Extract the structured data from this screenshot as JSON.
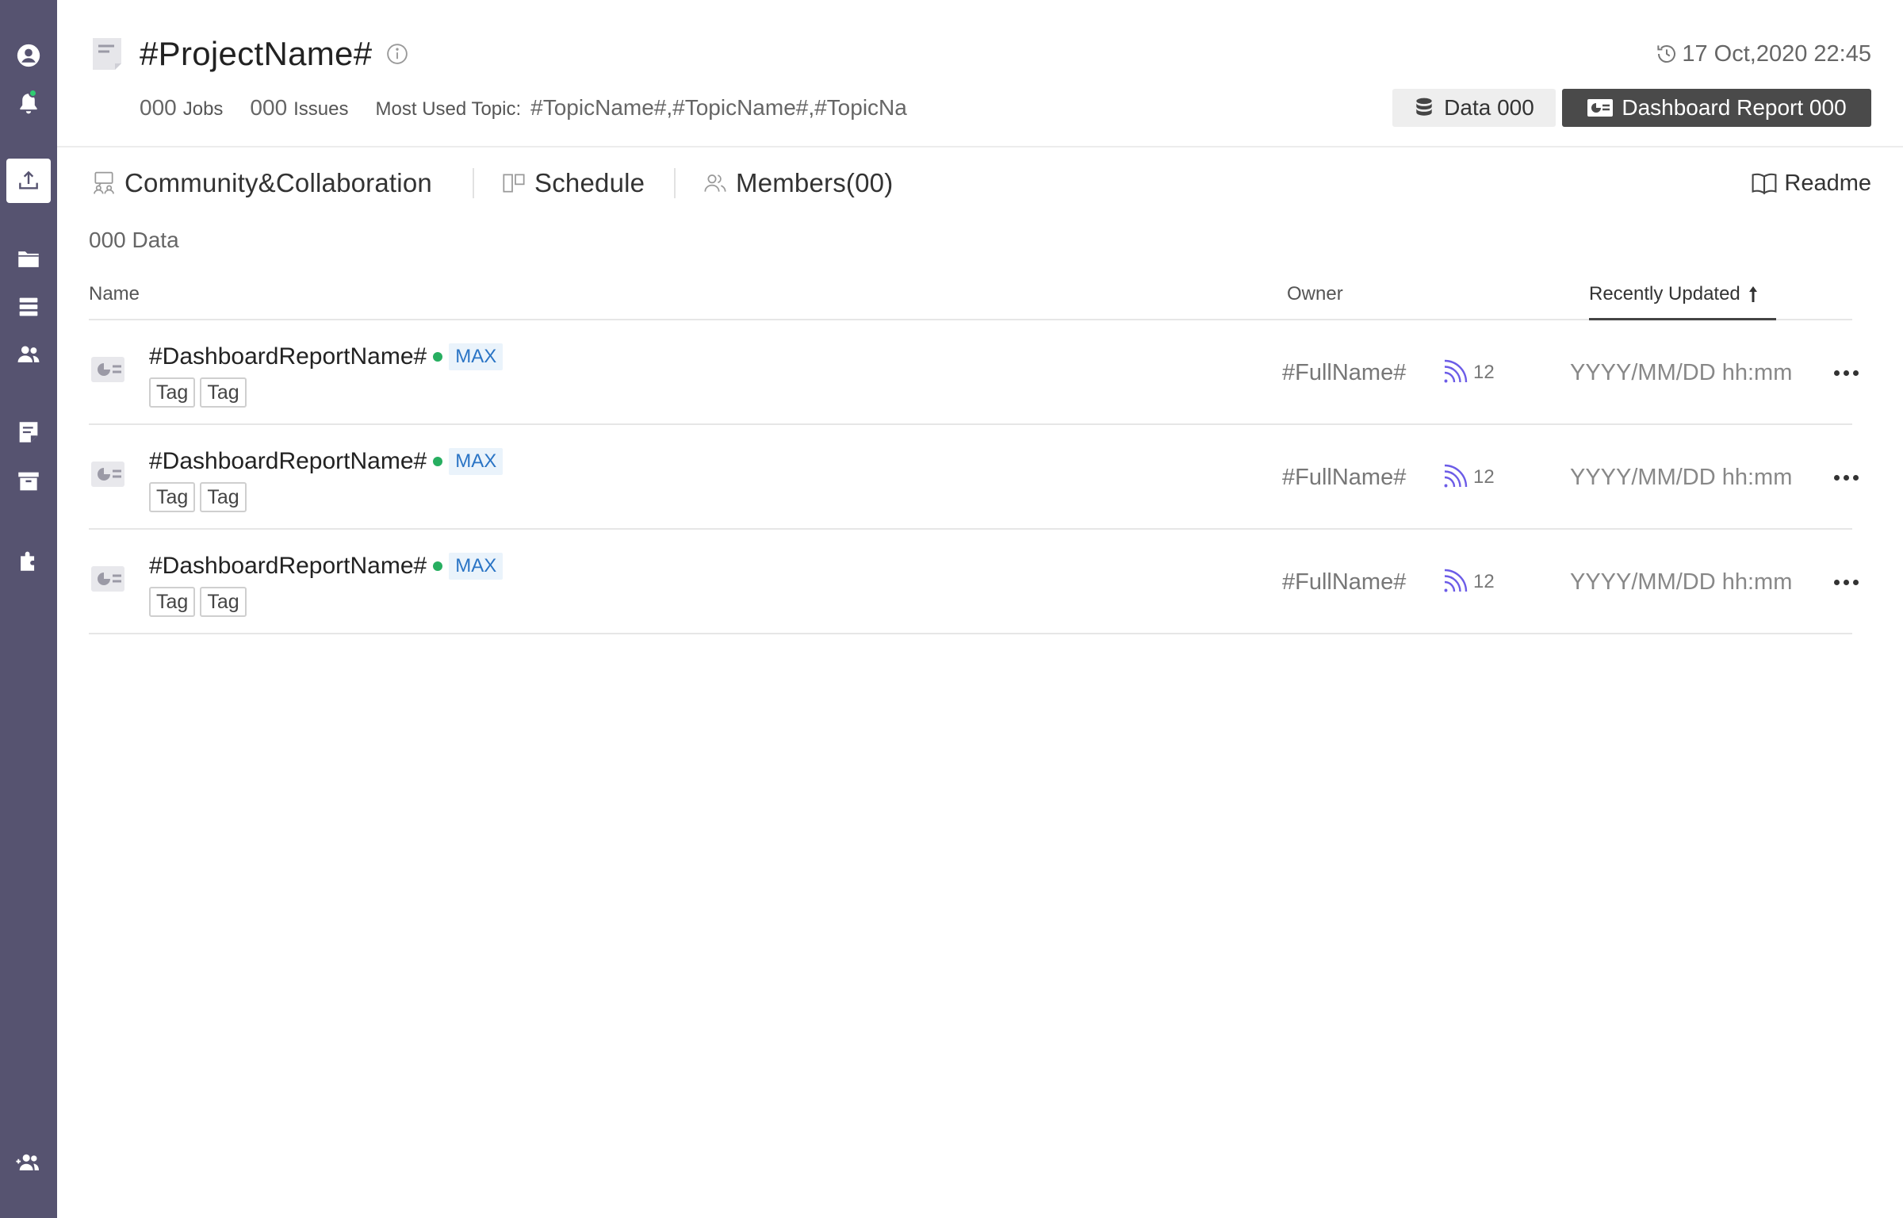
{
  "colors": {
    "sidebar_bg": "#565370",
    "accent_green": "#2ecc71",
    "badge_blue": "#2a74c5",
    "subscribe_purple": "#6c5ce7",
    "dark_button": "#4a4a4a"
  },
  "sidebar": {
    "icons": [
      "user-circle-icon",
      "bell-icon",
      "upload-icon",
      "folder-icon",
      "database-icon",
      "users-icon",
      "document-icon",
      "archive-icon",
      "puzzle-icon",
      "add-user-icon"
    ]
  },
  "header": {
    "title": "#ProjectName#",
    "timestamp": "17 Oct,2020 22:45",
    "jobs_count": "000",
    "jobs_label": "Jobs",
    "issues_count": "000",
    "issues_label": "Issues",
    "topic_label": "Most Used Topic:",
    "topic_value": "#TopicName#,#TopicName#,#TopicNa",
    "data_button": "Data 000",
    "report_button": "Dashboard Report 000"
  },
  "tabs": [
    {
      "label": "Community&Collaboration",
      "icon": "community-icon"
    },
    {
      "label": "Schedule",
      "icon": "schedule-icon"
    },
    {
      "label": "Members(00)",
      "icon": "members-icon"
    }
  ],
  "readme": "Readme",
  "data_count": "000 Data",
  "table": {
    "columns": {
      "name": "Name",
      "owner": "Owner",
      "updated": "Recently Updated"
    },
    "rows": [
      {
        "name": "#DashboardReportName#",
        "badge": "MAX",
        "tags": [
          "Tag",
          "Tag"
        ],
        "owner": "#FullName#",
        "subscribers": "12",
        "updated": "YYYY/MM/DD hh:mm"
      },
      {
        "name": "#DashboardReportName#",
        "badge": "MAX",
        "tags": [
          "Tag",
          "Tag"
        ],
        "owner": "#FullName#",
        "subscribers": "12",
        "updated": "YYYY/MM/DD hh:mm"
      },
      {
        "name": "#DashboardReportName#",
        "badge": "MAX",
        "tags": [
          "Tag",
          "Tag"
        ],
        "owner": "#FullName#",
        "subscribers": "12",
        "updated": "YYYY/MM/DD hh:mm"
      }
    ]
  }
}
